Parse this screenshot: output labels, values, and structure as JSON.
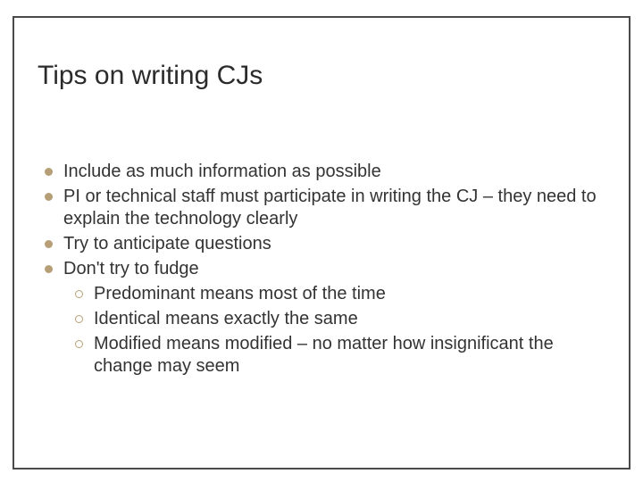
{
  "title": "Tips on writing CJs",
  "bullets": [
    {
      "text": "Include as much information as possible"
    },
    {
      "text": "PI or technical staff must participate in writing the CJ – they need to explain the technology clearly"
    },
    {
      "text": "Try to anticipate questions"
    },
    {
      "text": "Don't try to fudge"
    }
  ],
  "subbullets": [
    {
      "text": "Predominant means most of the time"
    },
    {
      "text": "Identical means exactly the same"
    },
    {
      "text": "Modified means modified – no matter how insignificant the change may seem"
    }
  ],
  "colors": {
    "bullet": "#b69f76",
    "frame": "#4a4a4a"
  }
}
